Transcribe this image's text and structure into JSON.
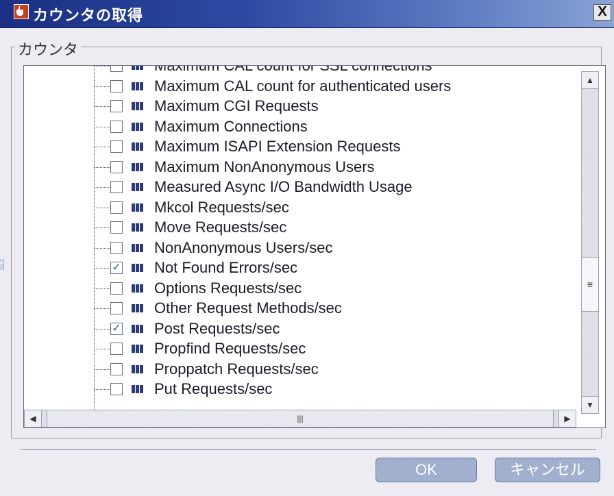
{
  "window": {
    "title": "カウンタの取得",
    "close_glyph": "X"
  },
  "group": {
    "label": "カウンタ"
  },
  "counters": [
    {
      "label": "Maximum CAL count for SSL connections",
      "checked": false
    },
    {
      "label": "Maximum CAL count for authenticated users",
      "checked": false
    },
    {
      "label": "Maximum CGI Requests",
      "checked": false
    },
    {
      "label": "Maximum Connections",
      "checked": false
    },
    {
      "label": "Maximum ISAPI Extension Requests",
      "checked": false
    },
    {
      "label": "Maximum NonAnonymous Users",
      "checked": false
    },
    {
      "label": "Measured Async I/O Bandwidth Usage",
      "checked": false
    },
    {
      "label": "Mkcol Requests/sec",
      "checked": false
    },
    {
      "label": "Move Requests/sec",
      "checked": false
    },
    {
      "label": "NonAnonymous Users/sec",
      "checked": false
    },
    {
      "label": "Not Found Errors/sec",
      "checked": true
    },
    {
      "label": "Options Requests/sec",
      "checked": false
    },
    {
      "label": "Other Request Methods/sec",
      "checked": false
    },
    {
      "label": "Post Requests/sec",
      "checked": true
    },
    {
      "label": "Propfind Requests/sec",
      "checked": false
    },
    {
      "label": "Proppatch Requests/sec",
      "checked": false
    },
    {
      "label": "Put Requests/sec",
      "checked": false
    }
  ],
  "scroll": {
    "up_glyph": "▲",
    "down_glyph": "▼",
    "left_glyph": "◀",
    "right_glyph": "▶",
    "v_thumb_glyph": "≡",
    "h_thumb_glyph": "|||"
  },
  "buttons": {
    "ok": "OK",
    "cancel": "キャンセル"
  },
  "colors": {
    "titlebar_start": "#1a2f82",
    "titlebar_end": "#8aa3d6",
    "check": "#1a54c8",
    "button_fill": "#a9b7d4"
  }
}
